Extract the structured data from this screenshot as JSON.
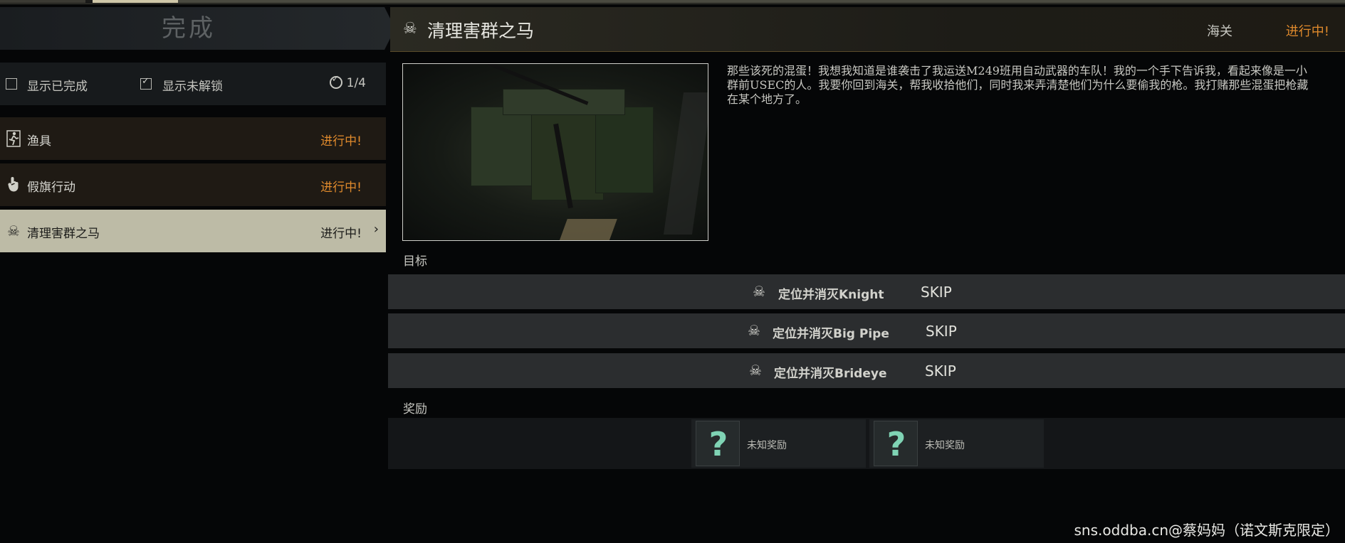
{
  "left": {
    "header_title": "完成",
    "filters": {
      "show_completed": "显示已完成",
      "show_locked": "显示未解锁",
      "counter": "1/4"
    },
    "quests": [
      {
        "icon": "runner-icon",
        "name": "渔具",
        "status": "进行中!"
      },
      {
        "icon": "hand-icon",
        "name": "假旗行动",
        "status": "进行中!"
      },
      {
        "icon": "skull-icon",
        "name": "清理害群之马",
        "status": "进行中!",
        "selected": true
      }
    ]
  },
  "detail": {
    "title": "清理害群之马",
    "location": "海关",
    "status": "进行中!",
    "description": "那些该死的混蛋！我想我知道是谁袭击了我运送M249班用自动武器的车队！我的一个手下告诉我，看起来像是一小群前USEC的人。我要你回到海关，帮我收拾他们，同时我来弄清楚他们为什么要偷我的枪。我打赌那些混蛋把枪藏在某个地方了。",
    "objectives_label": "目标",
    "objectives": [
      {
        "text": "定位并消灭Knight",
        "action": "SKIP"
      },
      {
        "text": "定位并消灭Big Pipe",
        "action": "SKIP"
      },
      {
        "text": "定位并消灭Brideye",
        "action": "SKIP"
      }
    ],
    "rewards_label": "奖励",
    "rewards": [
      {
        "symbol": "?",
        "label": "未知奖励"
      },
      {
        "symbol": "?",
        "label": "未知奖励"
      }
    ]
  },
  "watermark": "sns.oddba.cn@蔡妈妈（诺文斯克限定）",
  "colors": {
    "accent": "#e08a2c",
    "selected_bg": "#bdbba6",
    "reward_icon": "#7fd3b4"
  }
}
